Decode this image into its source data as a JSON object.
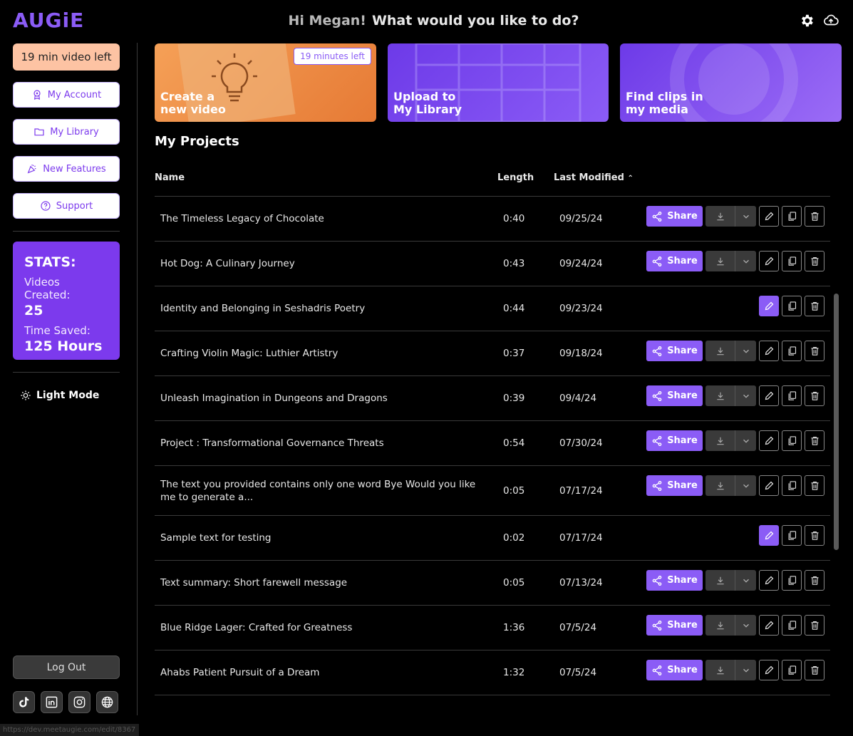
{
  "app": {
    "logo": "AUGiE"
  },
  "header": {
    "hi": "Hi Megan!",
    "question": "What would you like to do?"
  },
  "sidebar": {
    "video_left": "19 min video left",
    "items": [
      {
        "label": "My Account",
        "icon": "account-icon"
      },
      {
        "label": "My Library",
        "icon": "folder-icon"
      },
      {
        "label": "New Features",
        "icon": "party-icon"
      },
      {
        "label": "Support",
        "icon": "help-icon"
      }
    ],
    "stats": {
      "title": "STATS:",
      "videos_label": "Videos Created:",
      "videos_value": "25",
      "time_label": "Time Saved:",
      "time_value": "125 Hours"
    },
    "light_mode": "Light Mode",
    "logout": "Log Out"
  },
  "cards": [
    {
      "title": "Create a\nnew video",
      "badge": "19 minutes left"
    },
    {
      "title": "Upload to\nMy Library"
    },
    {
      "title": "Find clips in\nmy media"
    }
  ],
  "projects": {
    "title": "My Projects",
    "columns": {
      "name": "Name",
      "length": "Length",
      "modified": "Last Modified"
    },
    "share_label": "Share",
    "rows": [
      {
        "name": "The Timeless Legacy of Chocolate",
        "length": "0:40",
        "modified": "09/25/24",
        "shareable": true
      },
      {
        "name": "Hot Dog: A Culinary Journey",
        "length": "0:43",
        "modified": "09/24/24",
        "shareable": true
      },
      {
        "name": "Identity and Belonging in Seshadris Poetry",
        "length": "0:44",
        "modified": "09/23/24",
        "shareable": false
      },
      {
        "name": "Crafting Violin Magic: Luthier Artistry",
        "length": "0:37",
        "modified": "09/18/24",
        "shareable": true
      },
      {
        "name": "Unleash Imagination in Dungeons and Dragons",
        "length": "0:39",
        "modified": "09/4/24",
        "shareable": true
      },
      {
        "name": "Project : Transformational Governance Threats",
        "length": "0:54",
        "modified": "07/30/24",
        "shareable": true
      },
      {
        "name": "The text you provided contains only one word Bye Would you like me to generate a...",
        "length": "0:05",
        "modified": "07/17/24",
        "shareable": true
      },
      {
        "name": "Sample text for testing",
        "length": "0:02",
        "modified": "07/17/24",
        "shareable": false
      },
      {
        "name": "Text summary: Short farewell message",
        "length": "0:05",
        "modified": "07/13/24",
        "shareable": true
      },
      {
        "name": "Blue Ridge Lager: Crafted for Greatness",
        "length": "1:36",
        "modified": "07/5/24",
        "shareable": true
      },
      {
        "name": "Ahabs Patient Pursuit of a Dream",
        "length": "1:32",
        "modified": "07/5/24",
        "shareable": true
      }
    ]
  },
  "status_url": "https://dev.meetaugie.com/edit/8367",
  "colors": {
    "accent": "#8b5cf6",
    "video_left_bg": "#fdc3a3",
    "card_orange": "#e67a35"
  }
}
